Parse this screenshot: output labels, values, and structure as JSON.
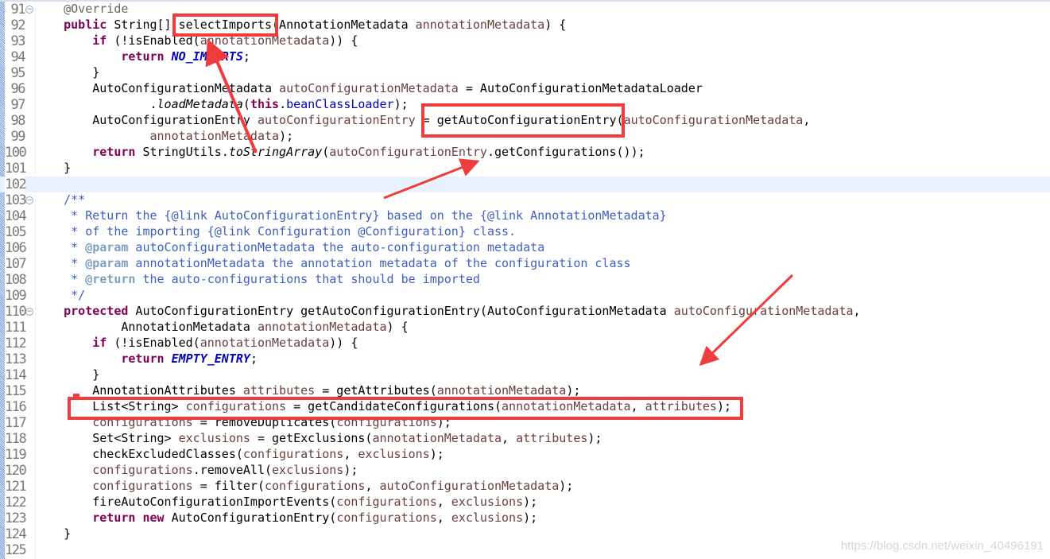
{
  "editor": {
    "current_line": 102,
    "lines": [
      {
        "n": "91",
        "fold": true,
        "t": [
          [
            "",
            "    "
          ],
          [
            "a",
            "@Override"
          ]
        ]
      },
      {
        "n": "92",
        "t": [
          [
            "",
            "    "
          ],
          [
            "k",
            "public"
          ],
          [
            "",
            " String[] selectImports(AnnotationMetadata "
          ],
          [
            "v",
            "annotationMetadata"
          ],
          [
            "",
            ") {"
          ]
        ]
      },
      {
        "n": "93",
        "t": [
          [
            "",
            "        "
          ],
          [
            "k",
            "if"
          ],
          [
            "",
            " (!isEnabled("
          ],
          [
            "v",
            "annotationMetadata"
          ],
          [
            "",
            ")) {"
          ]
        ]
      },
      {
        "n": "94",
        "t": [
          [
            "",
            "            "
          ],
          [
            "k",
            "return"
          ],
          [
            "",
            " "
          ],
          [
            "sf",
            "NO_IMPORTS"
          ],
          [
            "",
            ";"
          ]
        ]
      },
      {
        "n": "95",
        "t": [
          [
            "",
            "        }"
          ]
        ]
      },
      {
        "n": "96",
        "t": [
          [
            "",
            "        AutoConfigurationMetadata "
          ],
          [
            "v",
            "autoConfigurationMetadata"
          ],
          [
            "",
            " = AutoConfigurationMetadataLoader"
          ]
        ]
      },
      {
        "n": "97",
        "t": [
          [
            "",
            "                ."
          ],
          [
            "m",
            "loadMetadata"
          ],
          [
            "",
            "("
          ],
          [
            "k",
            "this"
          ],
          [
            "",
            "."
          ],
          [
            "f",
            "beanClassLoader"
          ],
          [
            "",
            ");"
          ]
        ]
      },
      {
        "n": "98",
        "t": [
          [
            "",
            "        AutoConfigurationEntry "
          ],
          [
            "v",
            "autoConfigurationEntry"
          ],
          [
            "",
            " = getAutoConfigurationEntry("
          ],
          [
            "v",
            "autoConfigurationMetadata"
          ],
          [
            "",
            ","
          ]
        ]
      },
      {
        "n": "99",
        "t": [
          [
            "",
            "                "
          ],
          [
            "v",
            "annotationMetadata"
          ],
          [
            "",
            ");"
          ]
        ]
      },
      {
        "n": "100",
        "t": [
          [
            "",
            "        "
          ],
          [
            "k",
            "return"
          ],
          [
            "",
            " StringUtils."
          ],
          [
            "m",
            "toStringArray"
          ],
          [
            "",
            "("
          ],
          [
            "v",
            "autoConfigurationEntry"
          ],
          [
            "",
            ".getConfigurations());"
          ]
        ]
      },
      {
        "n": "101",
        "t": [
          [
            "",
            "    }"
          ]
        ]
      },
      {
        "n": "102",
        "t": []
      },
      {
        "n": "103",
        "fold": true,
        "t": [
          [
            "d",
            "    /**"
          ]
        ]
      },
      {
        "n": "104",
        "t": [
          [
            "d",
            "     * Return the {@link AutoConfigurationEntry} based on the {@link AnnotationMetadata}"
          ]
        ]
      },
      {
        "n": "105",
        "t": [
          [
            "d",
            "     * of the importing {@link Configuration @Configuration} class."
          ]
        ]
      },
      {
        "n": "106",
        "t": [
          [
            "d",
            "     * "
          ],
          [
            "dt",
            "@param"
          ],
          [
            "d",
            " autoConfigurationMetadata the auto-configuration metadata"
          ]
        ]
      },
      {
        "n": "107",
        "t": [
          [
            "d",
            "     * "
          ],
          [
            "dt",
            "@param"
          ],
          [
            "d",
            " annotationMetadata the annotation metadata of the configuration class"
          ]
        ]
      },
      {
        "n": "108",
        "t": [
          [
            "d",
            "     * "
          ],
          [
            "dt",
            "@return"
          ],
          [
            "d",
            " the auto-configurations that should be imported"
          ]
        ]
      },
      {
        "n": "109",
        "t": [
          [
            "d",
            "     */"
          ]
        ]
      },
      {
        "n": "110",
        "fold": true,
        "t": [
          [
            "",
            "    "
          ],
          [
            "k",
            "protected"
          ],
          [
            "",
            " AutoConfigurationEntry getAutoConfigurationEntry(AutoConfigurationMetadata "
          ],
          [
            "v",
            "autoConfigurationMetadata"
          ],
          [
            "",
            ","
          ]
        ]
      },
      {
        "n": "111",
        "t": [
          [
            "",
            "            AnnotationMetadata "
          ],
          [
            "v",
            "annotationMetadata"
          ],
          [
            "",
            ") {"
          ]
        ]
      },
      {
        "n": "112",
        "t": [
          [
            "",
            "        "
          ],
          [
            "k",
            "if"
          ],
          [
            "",
            " (!isEnabled("
          ],
          [
            "v",
            "annotationMetadata"
          ],
          [
            "",
            ")) {"
          ]
        ]
      },
      {
        "n": "113",
        "t": [
          [
            "",
            "            "
          ],
          [
            "k",
            "return"
          ],
          [
            "",
            " "
          ],
          [
            "sf",
            "EMPTY_ENTRY"
          ],
          [
            "",
            ";"
          ]
        ]
      },
      {
        "n": "114",
        "t": [
          [
            "",
            "        }"
          ]
        ]
      },
      {
        "n": "115",
        "t": [
          [
            "",
            "        AnnotationAttributes "
          ],
          [
            "v",
            "attributes"
          ],
          [
            "",
            " = getAttributes("
          ],
          [
            "v",
            "annotationMetadata"
          ],
          [
            "",
            ");"
          ]
        ]
      },
      {
        "n": "116",
        "t": [
          [
            "",
            "        List<String> "
          ],
          [
            "v",
            "configurations"
          ],
          [
            "",
            " = getCandidateConfigurations("
          ],
          [
            "v",
            "annotationMetadata"
          ],
          [
            "",
            ", "
          ],
          [
            "v",
            "attributes"
          ],
          [
            "",
            ");"
          ]
        ]
      },
      {
        "n": "117",
        "t": [
          [
            "",
            "        "
          ],
          [
            "v",
            "configurations"
          ],
          [
            "",
            " = removeDuplicates("
          ],
          [
            "v",
            "configurations"
          ],
          [
            "",
            ");"
          ]
        ]
      },
      {
        "n": "118",
        "t": [
          [
            "",
            "        Set<String> "
          ],
          [
            "v",
            "exclusions"
          ],
          [
            "",
            " = getExclusions("
          ],
          [
            "v",
            "annotationMetadata"
          ],
          [
            "",
            ", "
          ],
          [
            "v",
            "attributes"
          ],
          [
            "",
            ");"
          ]
        ]
      },
      {
        "n": "119",
        "t": [
          [
            "",
            "        checkExcludedClasses("
          ],
          [
            "v",
            "configurations"
          ],
          [
            "",
            ", "
          ],
          [
            "v",
            "exclusions"
          ],
          [
            "",
            ");"
          ]
        ]
      },
      {
        "n": "120",
        "t": [
          [
            "",
            "        "
          ],
          [
            "v",
            "configurations"
          ],
          [
            "",
            ".removeAll("
          ],
          [
            "v",
            "exclusions"
          ],
          [
            "",
            ");"
          ]
        ]
      },
      {
        "n": "121",
        "t": [
          [
            "",
            "        "
          ],
          [
            "v",
            "configurations"
          ],
          [
            "",
            " = filter("
          ],
          [
            "v",
            "configurations"
          ],
          [
            "",
            ", "
          ],
          [
            "v",
            "autoConfigurationMetadata"
          ],
          [
            "",
            ");"
          ]
        ]
      },
      {
        "n": "122",
        "t": [
          [
            "",
            "        fireAutoConfigurationImportEvents("
          ],
          [
            "v",
            "configurations"
          ],
          [
            "",
            ", "
          ],
          [
            "v",
            "exclusions"
          ],
          [
            "",
            ");"
          ]
        ]
      },
      {
        "n": "123",
        "t": [
          [
            "",
            "        "
          ],
          [
            "k",
            "return"
          ],
          [
            "",
            " "
          ],
          [
            "k",
            "new"
          ],
          [
            "",
            " AutoConfigurationEntry("
          ],
          [
            "v",
            "configurations"
          ],
          [
            "",
            ", "
          ],
          [
            "v",
            "exclusions"
          ],
          [
            "",
            ");"
          ]
        ]
      },
      {
        "n": "124",
        "t": [
          [
            "",
            "    }"
          ]
        ]
      },
      {
        "n": "125",
        "t": []
      }
    ]
  },
  "annotation_color": "#f03c3c",
  "watermark": "https://blog.csdn.net/weixin_40496191"
}
